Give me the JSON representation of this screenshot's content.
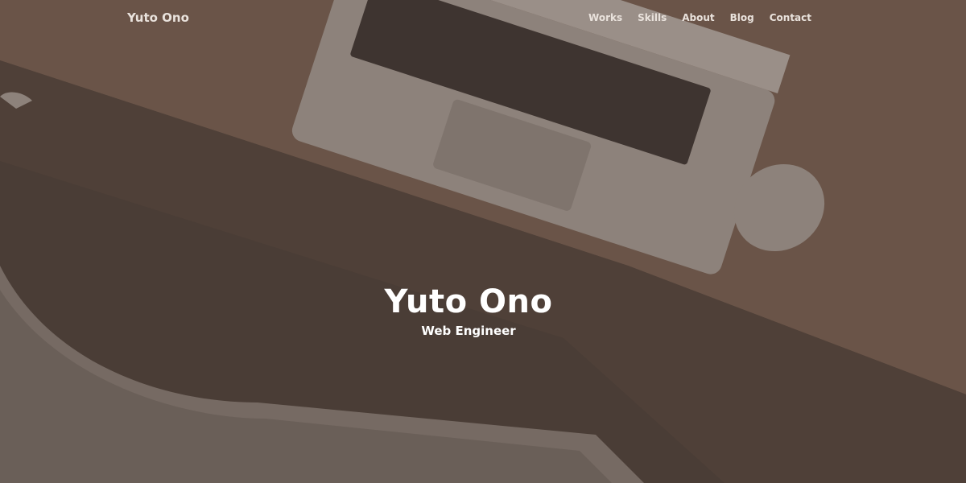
{
  "nav": {
    "brand": "Yuto Ono",
    "items": [
      {
        "label": "Works"
      },
      {
        "label": "Skills"
      },
      {
        "label": "About"
      },
      {
        "label": "Blog"
      },
      {
        "label": "Contact"
      }
    ]
  },
  "hero": {
    "title": "Yuto Ono",
    "subtitle": "Web Engineer"
  },
  "colors": {
    "overlay": "#4a3d36",
    "desk": "#6a5448",
    "text": "#ffffff"
  }
}
